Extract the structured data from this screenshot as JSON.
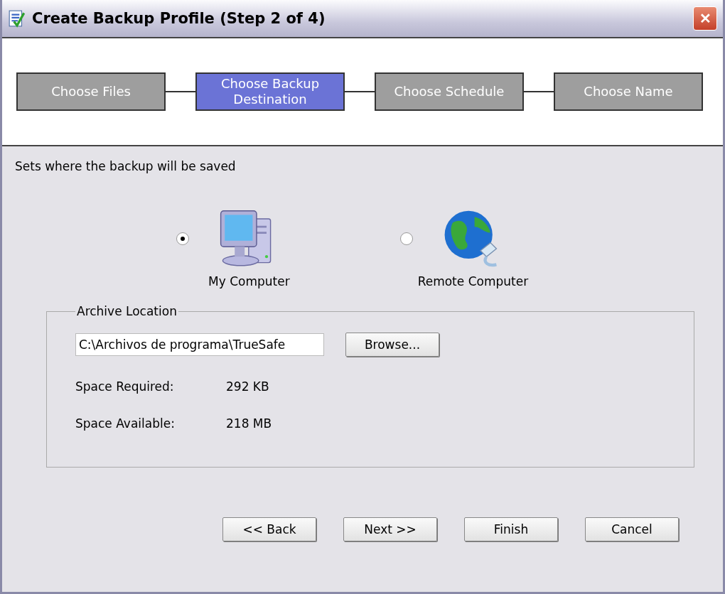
{
  "window": {
    "title": "Create Backup Profile (Step 2 of 4)",
    "close": "✕"
  },
  "steps": [
    {
      "label": "Choose Files",
      "selected": false
    },
    {
      "label": "Choose Backup Destination",
      "selected": true
    },
    {
      "label": "Choose Schedule",
      "selected": false
    },
    {
      "label": "Choose Name",
      "selected": false
    }
  ],
  "description": "Sets where the backup will be saved",
  "destinations": [
    {
      "label": "My Computer",
      "kind": "computer",
      "selected": true
    },
    {
      "label": "Remote Computer",
      "kind": "globe",
      "selected": false
    }
  ],
  "archive": {
    "legend": "Archive Location",
    "path": "C:\\Archivos de programa\\TrueSafe",
    "browse": "Browse...",
    "rows": [
      {
        "label": "Space Required:",
        "value": "292 KB"
      },
      {
        "label": "Space Available:",
        "value": "218 MB"
      }
    ]
  },
  "buttons": [
    "<< Back",
    "Next >>",
    "Finish",
    "Cancel"
  ]
}
